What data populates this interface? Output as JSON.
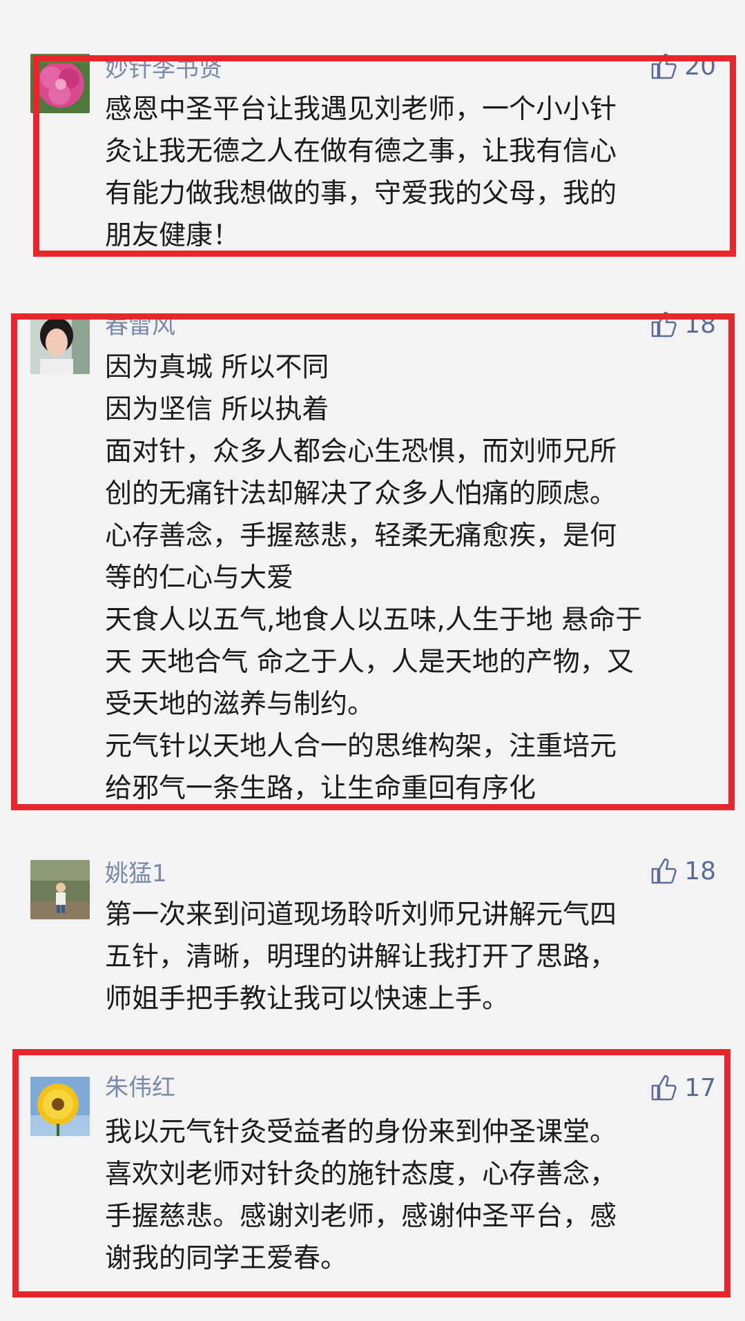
{
  "colors": {
    "background": "#f3f3f3",
    "name_text": "#7a8aa6",
    "body_text": "#1b1b1b",
    "like_accent": "#5a6c92",
    "highlight_border": "#e8262b"
  },
  "comments": [
    {
      "name": "妙针李书贤",
      "likes": "20",
      "avatar_icon": "pink-flower-icon",
      "lines": [
        "感恩中圣平台让我遇见刘老师，一个小小针",
        "灸让我无德之人在做有德之事，让我有信心",
        "有能力做我想做的事，守爱我的父母，我的",
        "朋友健康！"
      ]
    },
    {
      "name": "春雷风",
      "likes": "18",
      "avatar_icon": "woman-portrait-icon",
      "lines": [
        "因为真城 所以不同",
        "因为坚信 所以执着",
        "面对针，众多人都会心生恐惧，而刘师兄所",
        "创的无痛针法却解决了众多人怕痛的顾虑。",
        "心存善念，手握慈悲，轻柔无痛愈疾，是何",
        "等的仁心与大爱",
        "天食人以五气,地食人以五味,人生于地 悬命于",
        "天 天地合气  命之于人，人是天地的产物，又",
        "受天地的滋养与制约。",
        "元气针以天地人合一的思维构架，注重培元",
        "给邪气一条生路，让生命重回有序化"
      ]
    },
    {
      "name": "姚猛1",
      "likes": "18",
      "avatar_icon": "outdoor-child-icon",
      "lines": [
        "第一次来到问道现场聆听刘师兄讲解元气四",
        "五针，清晰，明理的讲解让我打开了思路，",
        "师姐手把手教让我可以快速上手。"
      ]
    },
    {
      "name": "朱伟红",
      "likes": "17",
      "avatar_icon": "sunflower-icon",
      "lines": [
        "我以元气针灸受益者的身份来到仲圣课堂。",
        "喜欢刘老师对针灸的施针态度，心存善念，",
        "手握慈悲。感谢刘老师，感谢仲圣平台，感",
        "谢我的同学王爱春。"
      ]
    }
  ]
}
